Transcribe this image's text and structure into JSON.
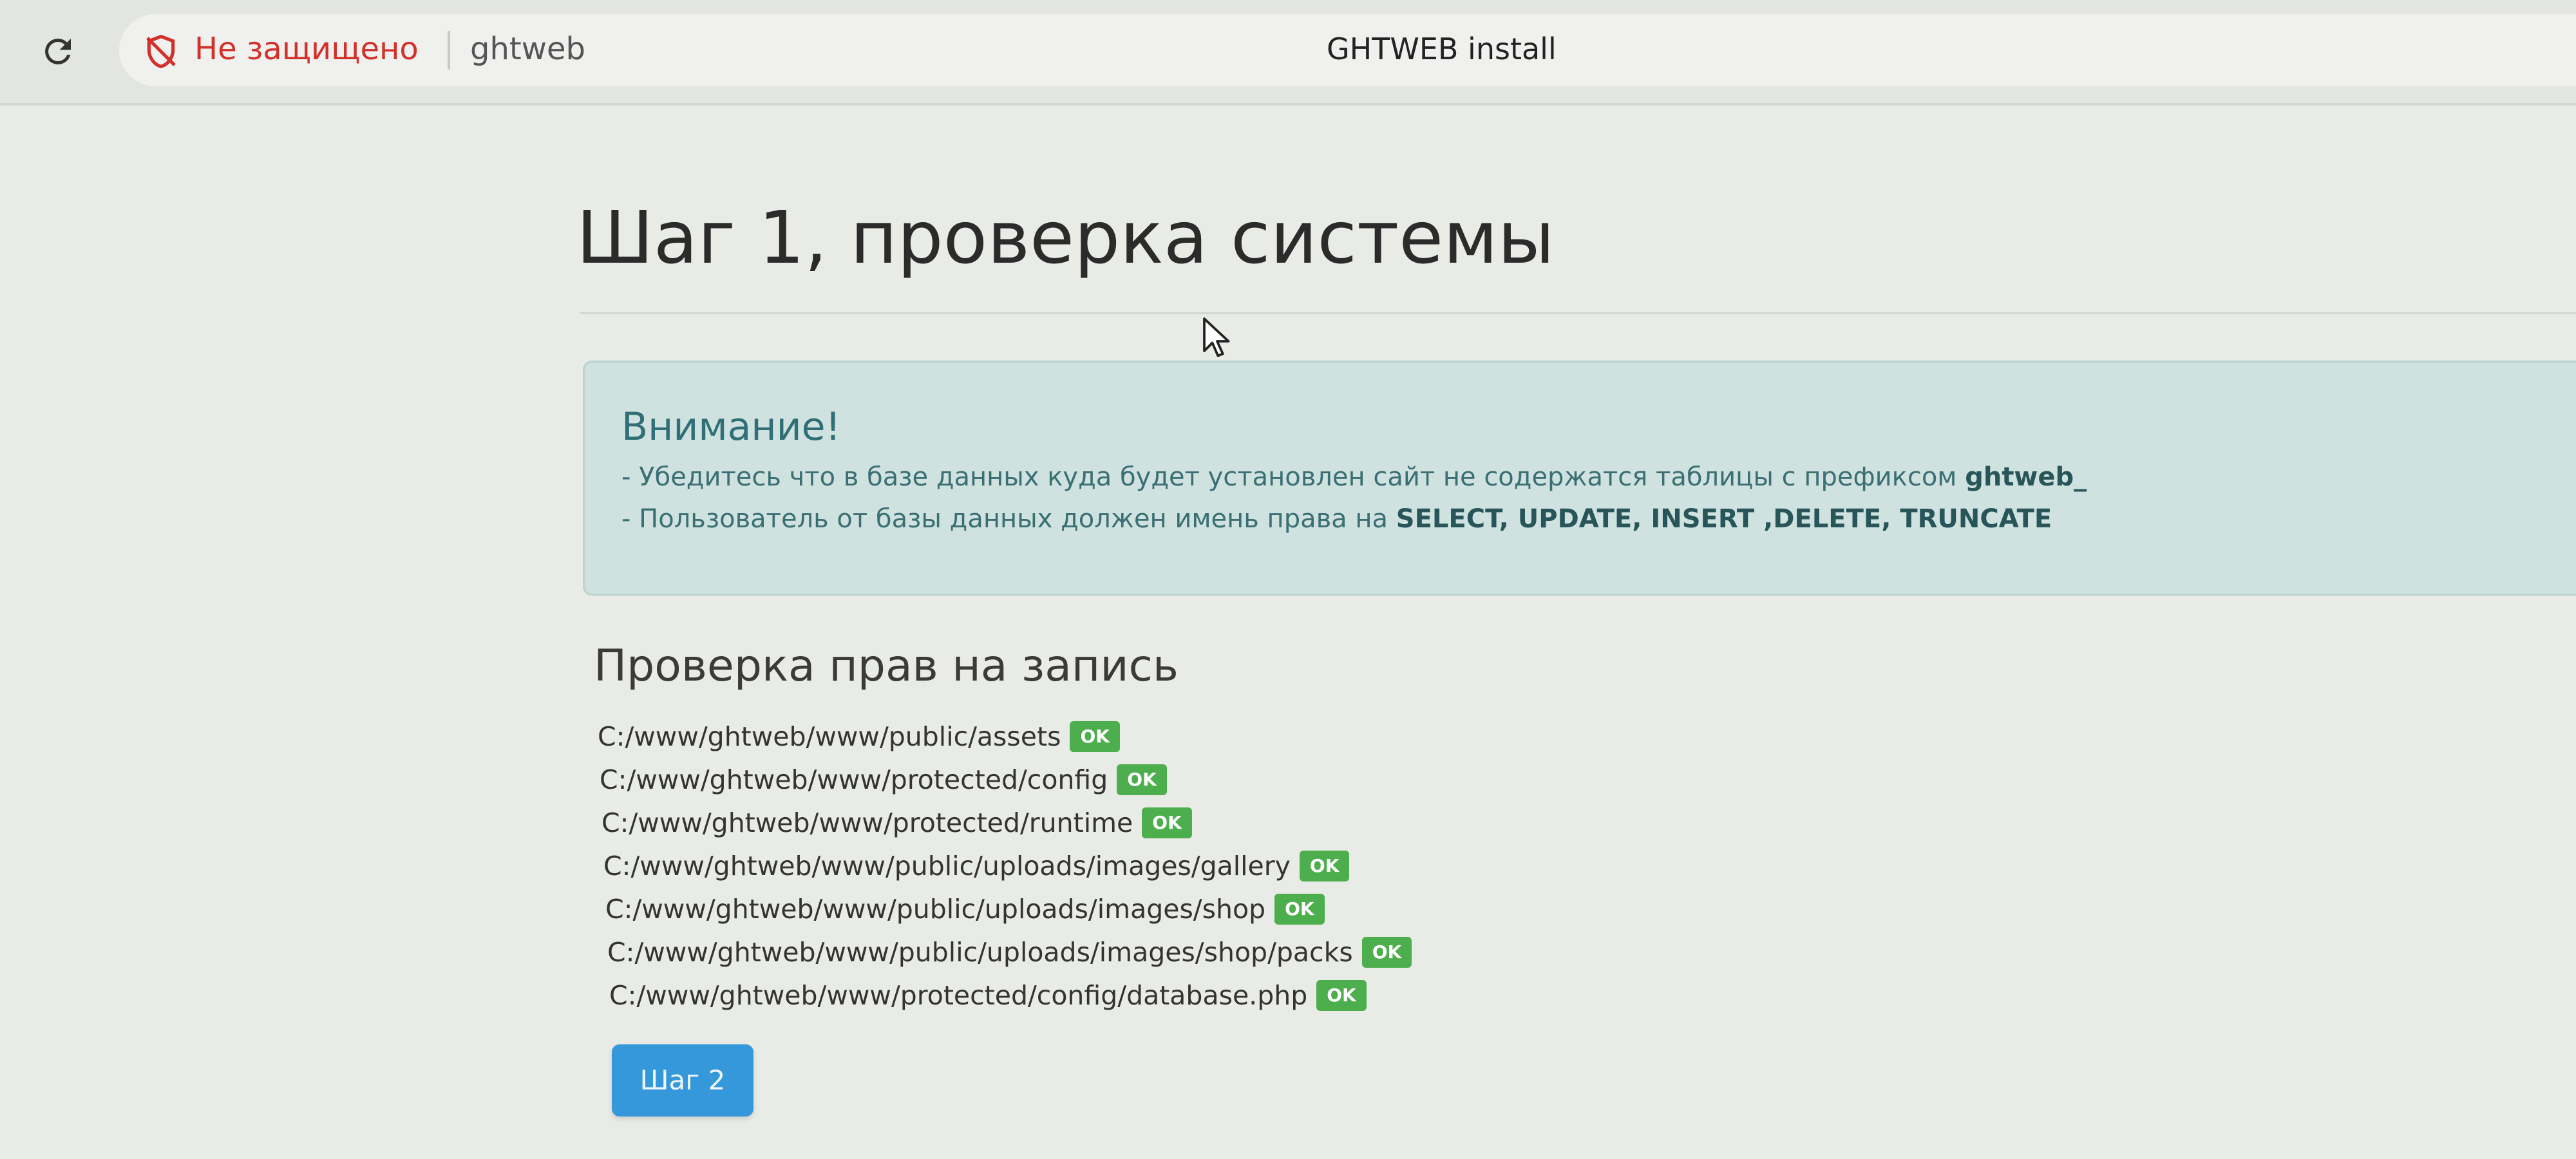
{
  "browser": {
    "security_label": "Не защищено",
    "url_host": "ghtweb",
    "page_title": "GHTWEB install",
    "icons": {
      "reload": "reload-icon",
      "security": "not-secure-icon"
    },
    "security_color": "#d2302a"
  },
  "page": {
    "heading": "Шаг 1, проверка системы",
    "alert": {
      "title": "Внимание!",
      "line1_text": "- Убедитесь что в базе данных куда будет установлен сайт не содержатся таблицы с префиксом ",
      "line1_bold": "ghtweb_",
      "line2_text": "- Пользователь от базы данных должен имень права на ",
      "line2_bold": "SELECT, UPDATE, INSERT ,DELETE, TRUNCATE",
      "background_color": "#cfe2df"
    },
    "permissions": {
      "heading": "Проверка прав на запись",
      "status_color": "#4cae4c",
      "items": [
        {
          "path": "C:/www/ghtweb/www/public/assets",
          "status": "OK"
        },
        {
          "path": "C:/www/ghtweb/www/protected/config",
          "status": "OK"
        },
        {
          "path": "C:/www/ghtweb/www/protected/runtime",
          "status": "OK"
        },
        {
          "path": "C:/www/ghtweb/www/public/uploads/images/gallery",
          "status": "OK"
        },
        {
          "path": "C:/www/ghtweb/www/public/uploads/images/shop",
          "status": "OK"
        },
        {
          "path": "C:/www/ghtweb/www/public/uploads/images/shop/packs",
          "status": "OK"
        },
        {
          "path": "C:/www/ghtweb/www/protected/config/database.php",
          "status": "OK"
        }
      ]
    },
    "next_button": {
      "label": "Шаг 2",
      "color": "#3498db"
    }
  }
}
